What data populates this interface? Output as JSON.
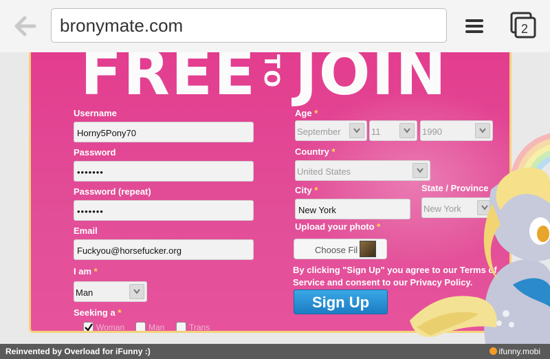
{
  "browser": {
    "url": "bronymate.com",
    "tab_count": "2"
  },
  "headline": {
    "left": "FREE",
    "middle": "TO",
    "right": "JOIN"
  },
  "form": {
    "username": {
      "label": "Username",
      "value": "Horny5Pony70"
    },
    "password": {
      "label": "Password",
      "value": "•••••••"
    },
    "password_repeat": {
      "label": "Password (repeat)",
      "value": "•••••••"
    },
    "email": {
      "label": "Email",
      "value": "Fuckyou@horsefucker.org"
    },
    "i_am": {
      "label": "I am",
      "value": "Man"
    },
    "seeking": {
      "label": "Seeking a",
      "options": [
        "Woman",
        "Man",
        "Trans"
      ],
      "checked": [
        "Woman"
      ]
    },
    "age": {
      "label": "Age",
      "month": "September",
      "day": "11",
      "year": "1990"
    },
    "country": {
      "label": "Country",
      "value": "United States"
    },
    "city": {
      "label": "City",
      "value": "New York"
    },
    "state": {
      "label": "State / Province",
      "value": "New York"
    },
    "photo": {
      "label": "Upload your photo",
      "button": "Choose Fil"
    },
    "required_mark": "*",
    "terms": "By clicking \"Sign Up\" you agree to our Terms of Service and consent to our Privacy Policy.",
    "submit": "Sign Up"
  },
  "footer": {
    "left": "Reinvented by Overload for iFunny :)",
    "right": "ifunny.mobi"
  },
  "colors": {
    "card": "#e33c8e",
    "border": "#f4d27a",
    "required": "#ffe14d",
    "button": "#2590d4"
  }
}
